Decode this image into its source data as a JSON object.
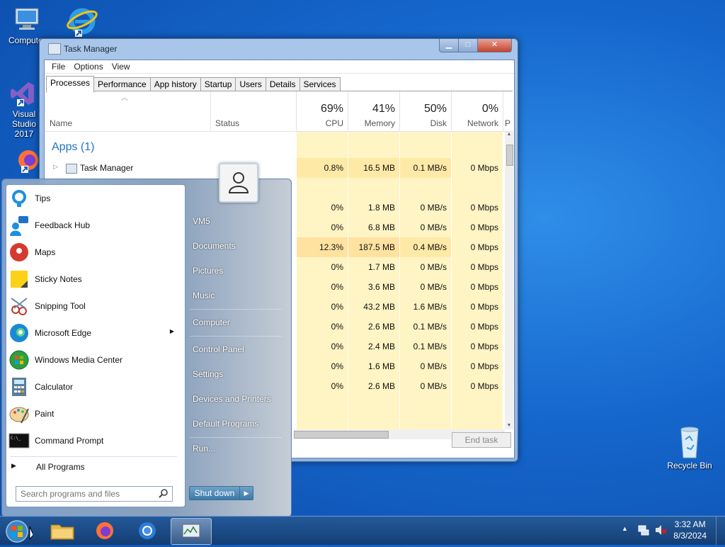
{
  "desktop": {
    "icons": [
      {
        "label": "Computer"
      },
      {
        "label": ""
      },
      {
        "label": "Visual Studio 2017"
      },
      {
        "label": ""
      },
      {
        "label": "Recycle Bin"
      }
    ]
  },
  "task_manager": {
    "title": "Task Manager",
    "menu": [
      "File",
      "Options",
      "View"
    ],
    "tabs": [
      "Processes",
      "Performance",
      "App history",
      "Startup",
      "Users",
      "Details",
      "Services"
    ],
    "active_tab": "Processes",
    "columns": {
      "name": "Name",
      "status": "Status",
      "cpu": {
        "pct": "69%",
        "label": "CPU"
      },
      "memory": {
        "pct": "41%",
        "label": "Memory"
      },
      "disk": {
        "pct": "50%",
        "label": "Disk"
      },
      "network": {
        "pct": "0%",
        "label": "Network"
      },
      "power": "P"
    },
    "group_apps": "Apps (1)",
    "app_row": {
      "name": "Task Manager",
      "cpu": "0.8%",
      "memory": "16.5 MB",
      "disk": "0.1 MB/s",
      "network": "0 Mbps"
    },
    "rows": [
      {
        "cpu": "0%",
        "memory": "1.8 MB",
        "disk": "0 MB/s",
        "network": "0 Mbps"
      },
      {
        "cpu": "0%",
        "memory": "6.8 MB",
        "disk": "0 MB/s",
        "network": "0 Mbps"
      },
      {
        "cpu": "12.3%",
        "memory": "187.5 MB",
        "disk": "0.4 MB/s",
        "network": "0 Mbps"
      },
      {
        "cpu": "0%",
        "memory": "1.7 MB",
        "disk": "0 MB/s",
        "network": "0 Mbps"
      },
      {
        "cpu": "0%",
        "memory": "3.6 MB",
        "disk": "0 MB/s",
        "network": "0 Mbps"
      },
      {
        "cpu": "0%",
        "memory": "43.2 MB",
        "disk": "1.6 MB/s",
        "network": "0 Mbps"
      },
      {
        "cpu": "0%",
        "memory": "2.6 MB",
        "disk": "0.1 MB/s",
        "network": "0 Mbps"
      },
      {
        "cpu": "0%",
        "memory": "2.4 MB",
        "disk": "0.1 MB/s",
        "network": "0 Mbps"
      },
      {
        "cpu": "0%",
        "memory": "1.6 MB",
        "disk": "0 MB/s",
        "network": "0 Mbps"
      },
      {
        "cpu": "0%",
        "memory": "2.6 MB",
        "disk": "0 MB/s",
        "network": "0 Mbps"
      }
    ],
    "end_task": "End task"
  },
  "start_menu": {
    "programs": [
      "Tips",
      "Feedback Hub",
      "Maps",
      "Sticky Notes",
      "Snipping Tool",
      "Microsoft Edge",
      "Windows Media Center",
      "Calculator",
      "Paint",
      "Command Prompt"
    ],
    "all_programs": "All Programs",
    "search_placeholder": "Search programs and files",
    "right_items": [
      "VM5",
      "Documents",
      "Pictures",
      "Music",
      "Computer",
      "Control Panel",
      "Settings",
      "Devices and Printers",
      "Default Programs",
      "Run..."
    ],
    "shutdown": "Shut down"
  },
  "taskbar": {
    "time": "3:32 AM",
    "date": "8/3/2024"
  },
  "colors": {
    "heat_light": "#fff4c4",
    "heat_mid": "#ffe9a6",
    "heat_high": "#ffd98a",
    "group_blue": "#1e73c8"
  }
}
